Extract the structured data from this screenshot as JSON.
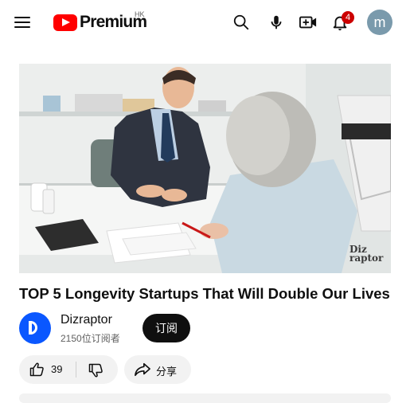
{
  "header": {
    "logo_text": "Premium",
    "region": "HK",
    "notification_count": "4",
    "avatar_letter": "m",
    "icons": [
      "menu-icon",
      "search-icon",
      "microphone-icon",
      "create-video-icon",
      "bell-icon"
    ]
  },
  "video": {
    "title": "TOP 5 Longevity Startups That Will Double Our Lives",
    "watermark_line1": "Diz",
    "watermark_line2": "raptor"
  },
  "channel": {
    "name": "Dizraptor",
    "subscribers": "2150位订阅者",
    "subscribe_label": "订阅",
    "brand_color": "#0a57ff"
  },
  "actions": {
    "like_count": "39",
    "share_label": "分享"
  }
}
